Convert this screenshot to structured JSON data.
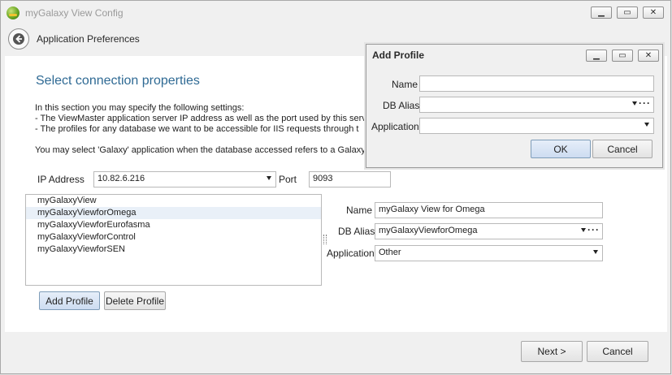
{
  "window": {
    "title": "myGalaxy View Config",
    "minimize_glyph": "▁",
    "maximize_glyph": "▭",
    "close_glyph": "✕"
  },
  "header": {
    "title": "Application Preferences",
    "back_icon": "back-arrow-icon"
  },
  "main": {
    "section_title": "Select connection properties",
    "intro": "In this section you may specify the following settings:",
    "bullet1": "-    The ViewMaster application server IP address as well as the port used by this serv",
    "bullet2": "-    The profiles for any database we want to be accessible for IIS requests through t",
    "note": "You may select 'Galaxy' application when the database accessed refers to a Galaxy s",
    "ip_label": "IP Address",
    "ip_value": "10.82.6.216",
    "port_label": "Port",
    "port_value": "9093",
    "profiles": [
      "myGalaxyView",
      "myGalaxyViewforOmega",
      "myGalaxyViewforEurofasma",
      "myGalaxyViewforControl",
      "myGalaxyViewforSEN"
    ],
    "selected_profile_index": 1,
    "name_label": "Name",
    "name_value": "myGalaxy View for Omega",
    "dbalias_label": "DB Alias",
    "dbalias_value": "myGalaxyViewforOmega",
    "application_label": "Application",
    "application_value": "Other",
    "ellipsis": "···",
    "add_profile": "Add Profile",
    "delete_profile": "Delete Profile"
  },
  "footer": {
    "next": "Next >",
    "cancel": "Cancel"
  },
  "dialog": {
    "title": "Add Profile",
    "name_label": "Name",
    "name_value": "",
    "dbalias_label": "DB Alias",
    "dbalias_value": "",
    "application_label": "Application",
    "application_value": "",
    "ellipsis": "···",
    "ok": "OK",
    "cancel": "Cancel"
  },
  "colors": {
    "accent": "#2f6a94",
    "selection": "#e9f0f8"
  }
}
